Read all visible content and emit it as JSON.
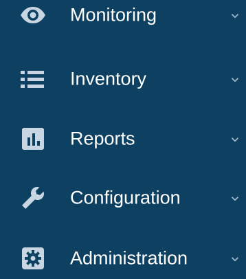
{
  "theme": {
    "background": "#0d4061",
    "text": "#ffffff",
    "icon": "#c7d6e2",
    "chevron": "#9fb8cb"
  },
  "menu": {
    "items": [
      {
        "label": "Monitoring",
        "icon": "eye-icon"
      },
      {
        "label": "Inventory",
        "icon": "list-icon"
      },
      {
        "label": "Reports",
        "icon": "bar-chart-icon"
      },
      {
        "label": "Configuration",
        "icon": "wrench-icon"
      },
      {
        "label": "Administration",
        "icon": "gear-icon"
      }
    ]
  }
}
